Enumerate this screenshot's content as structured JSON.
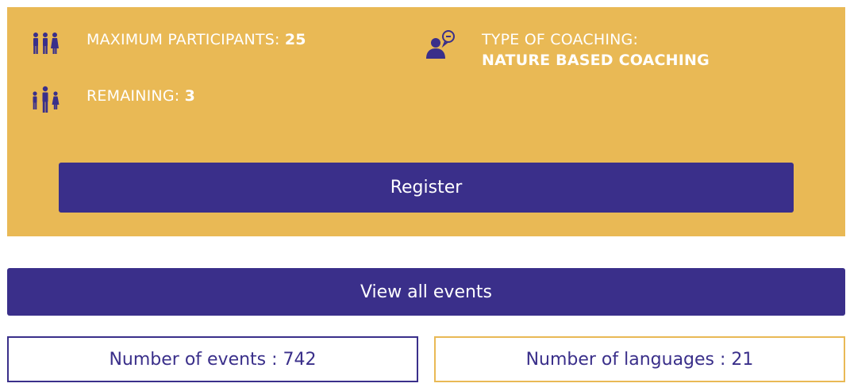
{
  "info": {
    "max_participants": {
      "label": "MAXIMUM PARTICIPANTS: ",
      "value": "25"
    },
    "remaining": {
      "label": "REMAINING: ",
      "value": "3"
    },
    "coaching_type": {
      "label": "TYPE OF COACHING:",
      "value": "NATURE BASED COACHING"
    }
  },
  "buttons": {
    "register": "Register",
    "view_all_events": "View all events"
  },
  "stats": {
    "events": "Number of events : 742",
    "languages": "Number of languages : 21"
  },
  "colors": {
    "panel": "#E9B955",
    "primary": "#3A2F8A",
    "text_light": "#ffffff"
  },
  "icons": {
    "max_participants": "group-people-icon",
    "remaining": "remaining-people-icon",
    "coaching_type": "coach-speech-icon"
  }
}
